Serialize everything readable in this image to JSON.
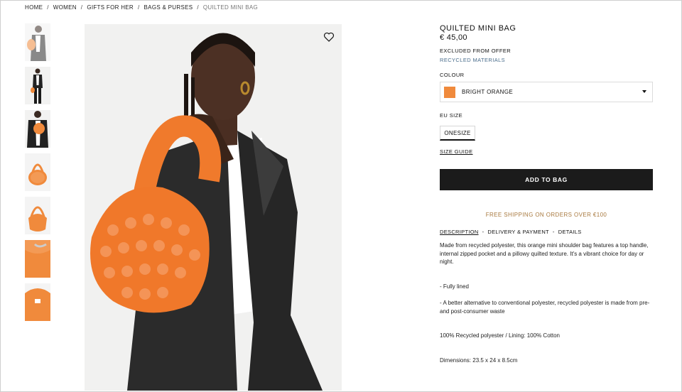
{
  "breadcrumb": [
    "HOME",
    "WOMEN",
    "GIFTS FOR HER",
    "BAGS & PURSES",
    "QUILTED MINI BAG"
  ],
  "product": {
    "title": "QUILTED MINI BAG",
    "price": "€ 45,00",
    "excluded": "EXCLUDED FROM OFFER",
    "recycled": "RECYCLED MATERIALS"
  },
  "colour": {
    "label": "COLOUR",
    "selected": "BRIGHT ORANGE",
    "swatch": "#f08a3c"
  },
  "size": {
    "label": "EU SIZE",
    "selected": "ONESIZE",
    "guide": "SIZE GUIDE"
  },
  "actions": {
    "add_to_bag": "ADD TO BAG"
  },
  "shipping": "FREE SHIPPING ON ORDERS OVER €100",
  "tabs": [
    "DESCRIPTION",
    "DELIVERY & PAYMENT",
    "DETAILS"
  ],
  "description": {
    "intro": "Made from recycled polyester, this orange mini shoulder bag features a top handle, internal zipped pocket and a pillowy quilted texture. It's a vibrant choice for day or night.",
    "bullet1": "- Fully lined",
    "bullet2": "- A better alternative to conventional polyester, recycled polyester is made from pre- and post-consumer waste",
    "composition": "100% Recycled polyester / Lining: 100% Cotton",
    "dimensions": "Dimensions: 23.5 x 24 x 8.5cm"
  },
  "icons": {
    "favorite": "heart-icon",
    "dropdown": "caret-down-icon"
  }
}
